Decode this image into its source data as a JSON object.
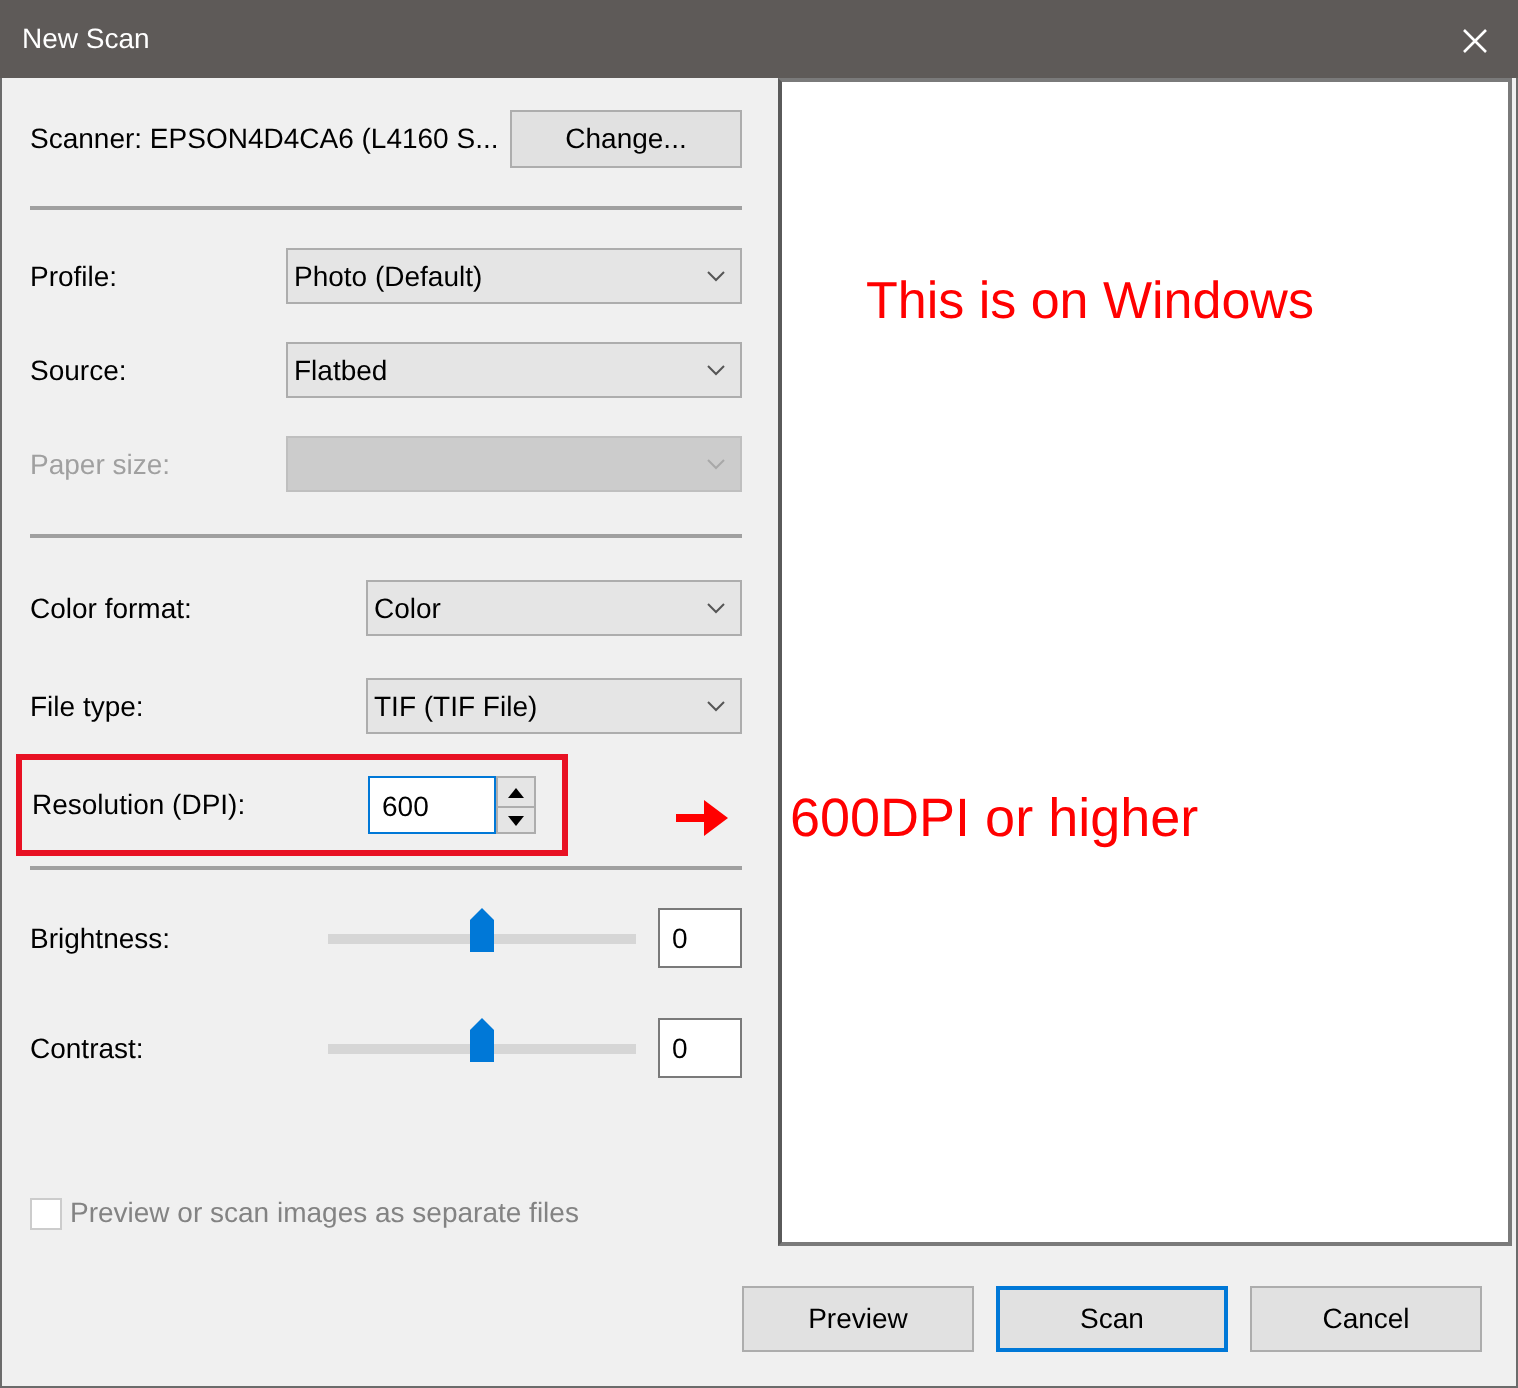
{
  "window": {
    "title": "New Scan"
  },
  "scanner": {
    "text": "Scanner: EPSON4D4CA6 (L4160 S...",
    "button": "Change..."
  },
  "groups": [
    {
      "rows": [
        {
          "kind": "dropdown",
          "label": "Profile:",
          "value": "Photo (Default)",
          "disabled": false
        },
        {
          "kind": "dropdown",
          "label": "Source:",
          "value": "Flatbed",
          "disabled": false
        },
        {
          "kind": "dropdown",
          "label": "Paper size:",
          "disabled": true
        }
      ]
    },
    {
      "rows": [
        {
          "kind": "dropdown",
          "label": "Color format:",
          "value": "Color",
          "disabled": false
        },
        {
          "kind": "dropdown",
          "label": "File type:",
          "value": "TIF (TIF File)",
          "disabled": false
        },
        {
          "kind": "spin",
          "label": "Resolution (DPI):",
          "value": "600",
          "highlighted": true
        }
      ]
    },
    {
      "rows": [
        {
          "kind": "slider",
          "label": "Brightness:",
          "level": 0.5,
          "value": "0"
        },
        {
          "kind": "slider",
          "label": "Contrast:",
          "level": 0.5,
          "value": "0"
        }
      ]
    }
  ],
  "checkbox": {
    "label": "Preview or scan images as separate files",
    "checked": false,
    "disabled": true
  },
  "annotations": [
    {
      "kind": "preview-note",
      "text": "This is on Windows"
    },
    {
      "kind": "arrow-note",
      "text": "600DPI or higher"
    }
  ],
  "buttons": [
    {
      "label": "Preview",
      "default": false
    },
    {
      "label": "Scan",
      "default": true
    },
    {
      "label": "Cancel",
      "default": false
    }
  ]
}
